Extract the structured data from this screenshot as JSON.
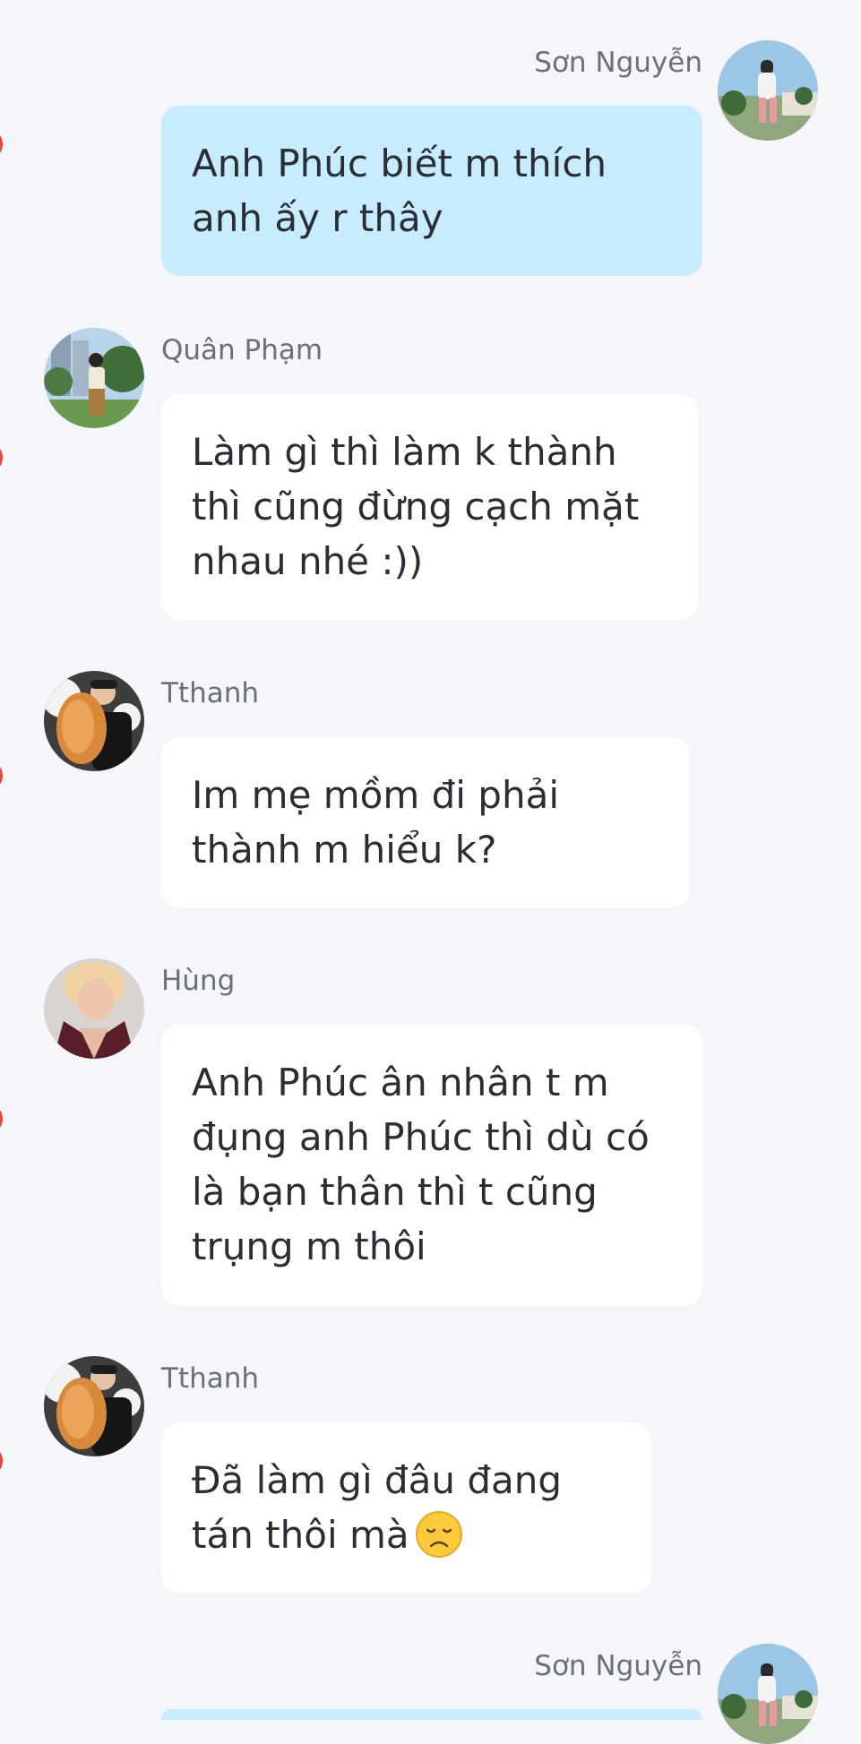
{
  "messages": [
    {
      "sender": "Sơn Nguyễn",
      "side": "right",
      "avatar": "son-nguyen-avatar",
      "text": "Anh Phúc biết m thích anh ấy r thây"
    },
    {
      "sender": "Quân Phạm",
      "side": "left",
      "avatar": "quan-pham-avatar",
      "text": "Làm gì thì làm k thành thì cũng đừng cạch mặt nhau nhé :))"
    },
    {
      "sender": "Tthanh",
      "side": "left",
      "avatar": "tthanh-avatar",
      "text": "Im mẹ mồm đi phải thành m hiểu k?"
    },
    {
      "sender": "Hùng",
      "side": "left",
      "avatar": "hung-avatar",
      "text": "Anh Phúc ân nhân t m đụng anh Phúc thì dù có là bạn thân thì t cũng trụng m thôi"
    },
    {
      "sender": "Tthanh",
      "side": "left",
      "avatar": "tthanh-avatar",
      "text": "Đã làm gì đâu đang tán thôi mà",
      "emoji": "disappointed-face-icon"
    },
    {
      "sender": "Sơn Nguyễn",
      "side": "right",
      "avatar": "son-nguyen-avatar",
      "text": ""
    }
  ],
  "colors": {
    "background": "#f5f6f9",
    "incoming_bubble": "#ffffff",
    "outgoing_bubble": "#c6ecfd",
    "sender_name": "#6b6f76",
    "message_text": "#2a2d33",
    "edge_marker": "#e8473f"
  }
}
